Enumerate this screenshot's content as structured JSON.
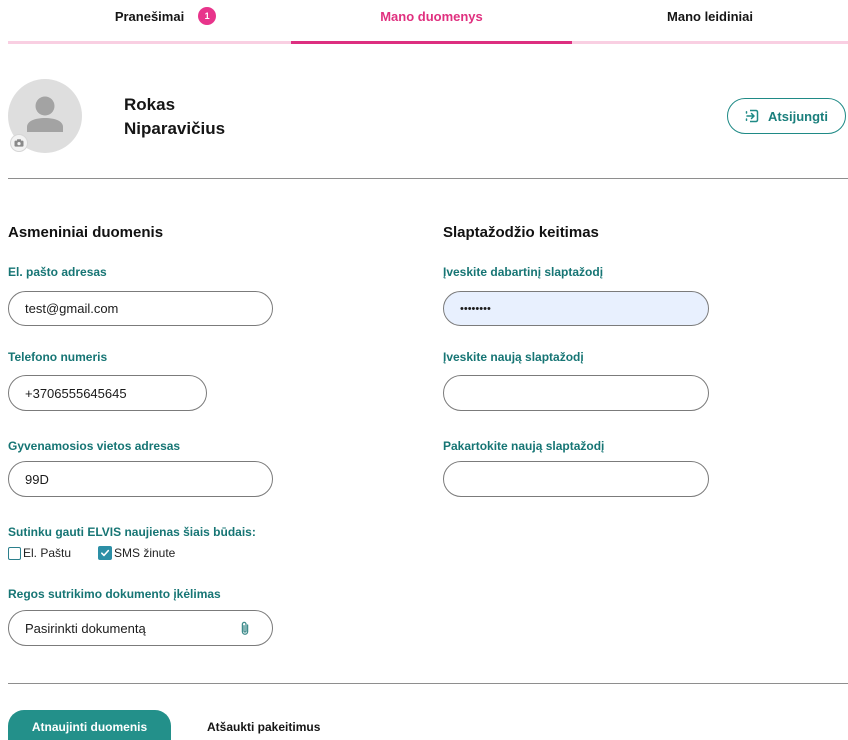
{
  "tabs": [
    {
      "label": "Pranešimai",
      "badge": "1",
      "active": false
    },
    {
      "label": "Mano duomenys",
      "active": true
    },
    {
      "label": "Mano leidiniai",
      "active": false
    }
  ],
  "profile": {
    "first_name": "Rokas",
    "last_name": "Niparavičius"
  },
  "logout": {
    "label": "Atsijungti"
  },
  "personal": {
    "heading": "Asmeniniai duomenis",
    "email": {
      "label": "El. pašto adresas",
      "value": "test@gmail.com"
    },
    "phone": {
      "label": "Telefono numeris",
      "value": "+3706555645645"
    },
    "address": {
      "label": "Gyvenamosios vietos adresas",
      "value": "99D"
    },
    "consent": {
      "label": "Sutinku gauti ELVIS naujienas šiais būdais:",
      "options": [
        {
          "label": "El. Paštu",
          "checked": false
        },
        {
          "label": "SMS žinute",
          "checked": true
        }
      ]
    },
    "document": {
      "label": "Regos sutrikimo dokumento įkėlimas",
      "button_text": "Pasirinkti dokumentą"
    }
  },
  "password": {
    "heading": "Slaptažodžio keitimas",
    "current": {
      "label": "Įveskite dabartinį slaptažodį",
      "value": "••••••••"
    },
    "new": {
      "label": "Įveskite naują slaptažodį"
    },
    "repeat": {
      "label": "Pakartokite naują slaptažodį"
    }
  },
  "actions": {
    "submit_label": "Atnaujinti duomenis",
    "cancel_label": "Atšaukti pakeitimus"
  },
  "icons": {
    "avatar": "person-icon",
    "avatar_upload": "camera-icon",
    "logout": "logout-icon",
    "attach": "paperclip-icon",
    "checkbox": "check-icon"
  },
  "colors": {
    "accent": "#1f8a86",
    "label": "#167574",
    "active_tab": "#e0307f",
    "badge": "#e8348b",
    "tab_underline": "#f9cfe2",
    "autofill_bg": "#e8f0fe",
    "checkbox": "#2c8fa6"
  }
}
